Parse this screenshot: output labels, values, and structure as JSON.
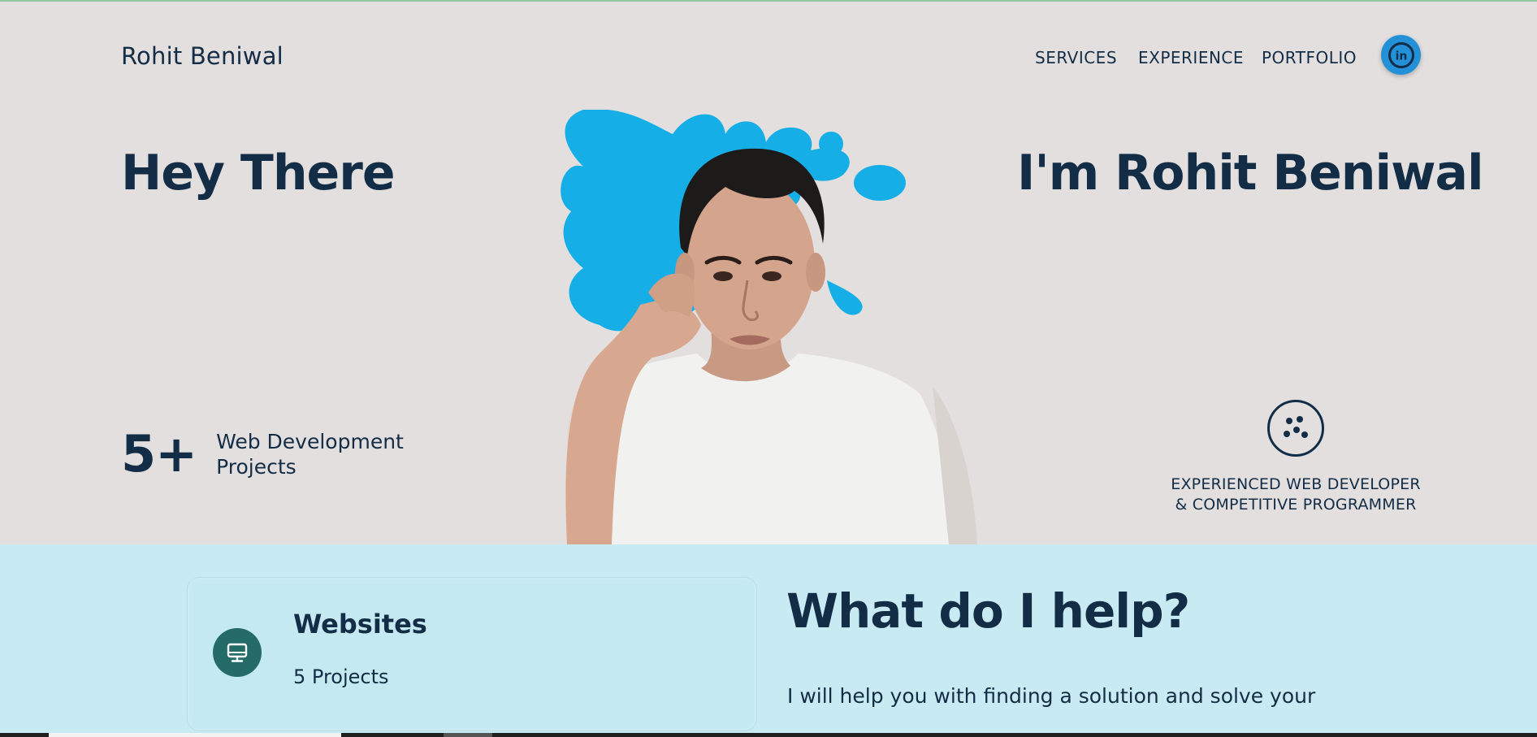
{
  "header": {
    "logo": "Rohit Beniwal",
    "nav": [
      "SERVICES",
      "EXPERIENCE",
      "PORTFOLIO"
    ],
    "linkedin_label": "in"
  },
  "hero": {
    "greeting": "Hey There",
    "intro": "I'm Rohit Beniwal",
    "stat_number": "5+",
    "stat_label": "Web Development Projects",
    "role_line1": "EXPERIENCED WEB DEVELOPER",
    "role_line2": "& COMPETITIVE PROGRAMMER"
  },
  "services": {
    "card_title": "Websites",
    "card_count": "5 Projects",
    "heading": "What do I help?",
    "description": "I will help you with finding a solution and solve your"
  },
  "colors": {
    "background": "#e3dfdf",
    "text": "#132d46",
    "band": "#c8ebf3",
    "accent_blue": "#2291d8",
    "service_icon_bg": "#256b68",
    "splash": "#16aee6"
  }
}
